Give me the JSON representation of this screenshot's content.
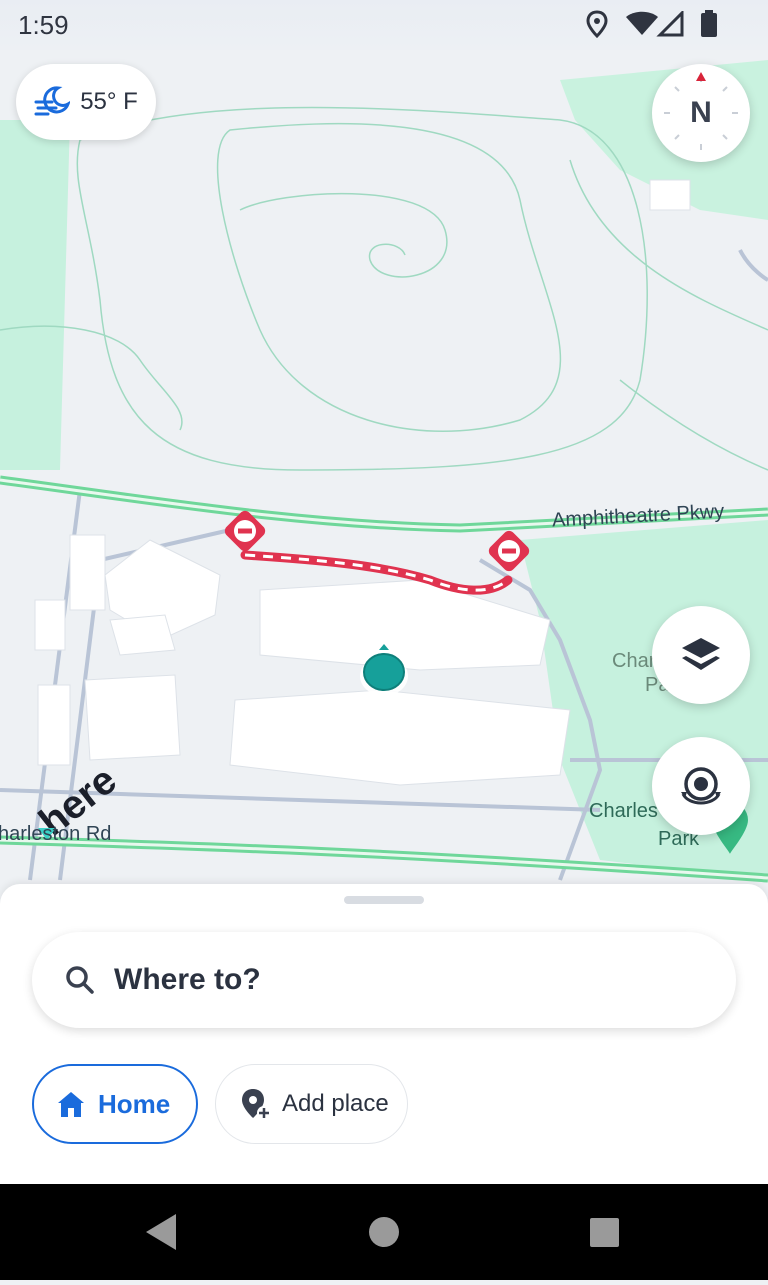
{
  "status": {
    "time": "1:59"
  },
  "weather": {
    "temperature": "55° F",
    "icon": "wind-moon-icon"
  },
  "compass": {
    "label": "N"
  },
  "map": {
    "labels": {
      "road_top": "Amphitheatre Pkwy",
      "road_bottom": "harleston Rd",
      "park_1_line1": "Char",
      "park_1_line2": "Pa",
      "park_2_line1": "Charles",
      "park_2_line2": "Park",
      "brand": "here"
    },
    "colors": {
      "route": "#e0334f",
      "position": "#16a09a",
      "parkland": "#bdeed8",
      "road": "#5ed38f"
    }
  },
  "search": {
    "placeholder": "Where to?"
  },
  "chips": {
    "home": "Home",
    "add_place": "Add place"
  },
  "colors": {
    "accent": "#1a6bdc"
  }
}
